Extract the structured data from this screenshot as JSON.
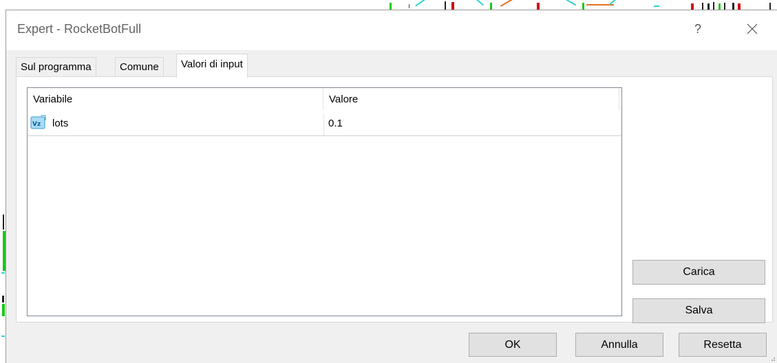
{
  "window": {
    "title": "Expert - RocketBotFull",
    "help_label": "?"
  },
  "tabs": [
    {
      "label": "Sul programma",
      "active": false
    },
    {
      "label": "Comune",
      "active": false
    },
    {
      "label": "Valori di input",
      "active": true
    }
  ],
  "inputs_table": {
    "columns": [
      "Variabile",
      "Valore"
    ],
    "rows": [
      {
        "variable": "lots",
        "value": "0.1",
        "icon": "variable-icon"
      }
    ]
  },
  "side_buttons": {
    "load_label": "Carica",
    "save_label": "Salva"
  },
  "footer_buttons": {
    "ok_label": "OK",
    "cancel_label": "Annulla",
    "reset_label": "Resetta"
  },
  "colors": {
    "dialog_bg": "#f0f0f0",
    "panel_bg": "#ffffff",
    "button_bg": "#e1e1e1",
    "button_border": "#adadad"
  }
}
